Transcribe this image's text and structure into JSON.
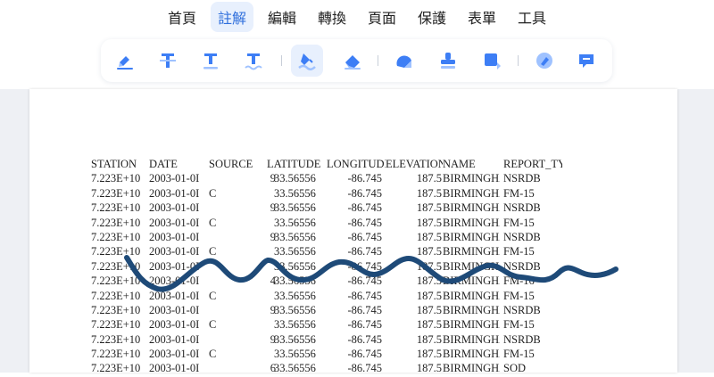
{
  "menu": {
    "items": [
      "首頁",
      "註解",
      "編輯",
      "轉換",
      "頁面",
      "保護",
      "表單",
      "工具"
    ],
    "active_index": 1
  },
  "toolbar": {
    "tools": [
      {
        "icon": "highlight-pen-icon",
        "active": false
      },
      {
        "icon": "text-strikethrough-icon",
        "active": false
      },
      {
        "icon": "text-underline-icon",
        "active": false
      },
      {
        "icon": "text-squiggly-icon",
        "active": false
      },
      {
        "icon": "freehand-draw-icon",
        "active": true
      },
      {
        "icon": "eraser-icon",
        "active": false
      },
      {
        "icon": "shape-icon",
        "active": false
      },
      {
        "icon": "stamp-icon",
        "active": false
      },
      {
        "icon": "area-highlight-icon",
        "active": false
      },
      {
        "icon": "signature-icon",
        "active": false
      },
      {
        "icon": "comment-icon",
        "active": false
      }
    ]
  },
  "document": {
    "headers": [
      "STATION",
      "DATE",
      "SOURCE",
      "LATITUDE",
      "LONGITUDE",
      "ELEVATION",
      "NAME",
      "REPORT_TYI"
    ],
    "rows": [
      [
        "7.223E+10",
        "2003-01-0I",
        "",
        "9",
        "33.56556",
        "-86.745",
        "187.5",
        "BIRMINGHAI",
        "NSRDB"
      ],
      [
        "7.223E+10",
        "2003-01-0I",
        "C",
        "",
        "33.56556",
        "-86.745",
        "187.5",
        "BIRMINGHAI",
        "FM-15"
      ],
      [
        "7.223E+10",
        "2003-01-0I",
        "",
        "9",
        "33.56556",
        "-86.745",
        "187.5",
        "BIRMINGHAI",
        "NSRDB"
      ],
      [
        "7.223E+10",
        "2003-01-0I",
        "C",
        "",
        "33.56556",
        "-86.745",
        "187.5",
        "BIRMINGHAI",
        "FM-15"
      ],
      [
        "7.223E+10",
        "2003-01-0I",
        "",
        "9",
        "33.56556",
        "-86.745",
        "187.5",
        "BIRMINGHAI",
        "NSRDB"
      ],
      [
        "7.223E+10",
        "2003-01-0I",
        "C",
        "",
        "33.56556",
        "-86.745",
        "187.5",
        "BIRMINGHAI",
        "FM-15"
      ],
      [
        "7.223E+10",
        "2003-01-0I",
        "",
        "",
        "33.56556",
        "-86.745",
        "187.5",
        "BIRMINGHAI",
        "NSRDB"
      ],
      [
        "7.223E+10",
        "2003-01-0I",
        "",
        "4",
        "33.56556",
        "-86.745",
        "187.5",
        "BIRMINGHAI",
        "FM-16"
      ],
      [
        "7.223E+10",
        "2003-01-0I",
        "C",
        "",
        "33.56556",
        "-86.745",
        "187.5",
        "BIRMINGHAI",
        "FM-15"
      ],
      [
        "7.223E+10",
        "2003-01-0I",
        "",
        "9",
        "33.56556",
        "-86.745",
        "187.5",
        "BIRMINGHAI",
        "NSRDB"
      ],
      [
        "7.223E+10",
        "2003-01-0I",
        "C",
        "",
        "33.56556",
        "-86.745",
        "187.5",
        "BIRMINGHAI",
        "FM-15"
      ],
      [
        "7.223E+10",
        "2003-01-0I",
        "",
        "9",
        "33.56556",
        "-86.745",
        "187.5",
        "BIRMINGHAI",
        "NSRDB"
      ],
      [
        "7.223E+10",
        "2003-01-0I",
        "C",
        "",
        "33.56556",
        "-86.745",
        "187.5",
        "BIRMINGHAI",
        "FM-15"
      ],
      [
        "7.223E+10",
        "2003-01-0I",
        "",
        "6",
        "33.56556",
        "-86.745",
        "187.5",
        "BIRMINGHAI",
        "SOD"
      ]
    ]
  },
  "colors": {
    "accent": "#2f6fdc",
    "icon_blue": "#3d7ef5",
    "ink_stroke": "#1e4a78"
  }
}
